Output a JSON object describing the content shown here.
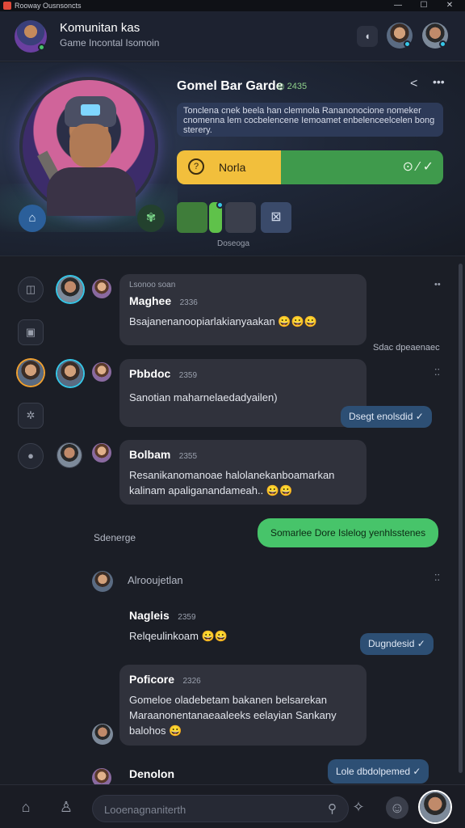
{
  "window": {
    "title": "Rooway Ousnsoncts",
    "minimize": "—",
    "maximize": "☐",
    "close": "✕"
  },
  "header": {
    "title": "Komunitan kas",
    "subtitle": "Game Incontal Isomoin",
    "chat_icon": "speech-bubble-icon"
  },
  "banner": {
    "game_title": "Gomel Bar Garde",
    "game_meta": "◎ 2435",
    "description": "Tonclena cnek beela han clemnola Rananonocione nomeker cnomenna lem cocbelencene Iemoamet enbelenceelcelen bong sterery.",
    "nodes_label": "Norla",
    "nodes_progress": 0.39,
    "tiles_caption": "Doseoga"
  },
  "messages": [
    {
      "name": "Maghee",
      "time": "2336",
      "text": "Bsajanenanoopiarlakianyaakan",
      "emoji": "😀😀😀",
      "header": "Lsonoo soan"
    },
    {
      "name": "Pbbdoc",
      "time": "2359",
      "text": "Sanotian maharnelaedadyailen)"
    },
    {
      "name": "Bolbam",
      "time": "2355",
      "text": "Resanikanomanoae halolanekanboamarkan kalinam apaliganandameah..",
      "emoji": "😀😀"
    },
    {
      "name": "Nagleis",
      "time": "2359",
      "text": "Relqeulinkoam",
      "emoji": "😀😀"
    },
    {
      "name": "Poficore",
      "time": "2326",
      "text": "Gomeloe oladebetam bakanen belsarekan Maraanonentanaeaaleeks eelayian Sankany balohos",
      "emoji": "😀"
    }
  ],
  "side_notes": {
    "note1": "Sdac dpeaenaec",
    "label_left": "Sdenerge",
    "outgoing1": "Dsegt enolsdid ✓",
    "outgoing_green": "Somarlee Dore Islelog yenhlsstenes",
    "system_text": "Alrooujetlan",
    "outgoing2": "Dugndesid ✓",
    "outgoing3": "Lole dbdolpemed ✓",
    "last_name": "Denolon"
  },
  "bottom": {
    "search_placeholder": "Looenagnaniterth"
  },
  "colors": {
    "accent_green": "#47c46a",
    "accent_yellow": "#f2bf3c",
    "accent_blue": "#2d4f74",
    "ring": "#36c7e8"
  }
}
